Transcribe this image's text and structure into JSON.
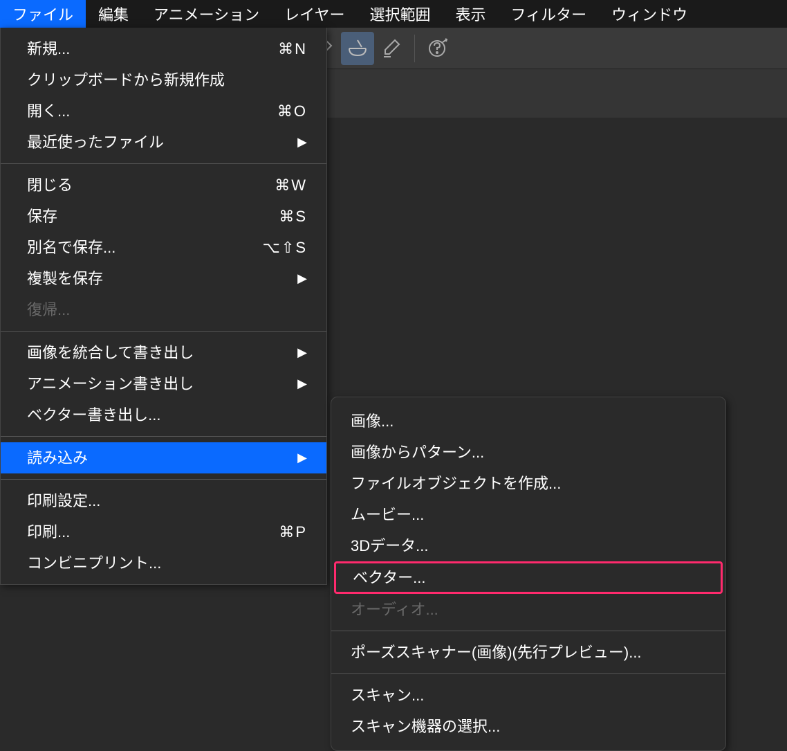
{
  "menubar": {
    "items": [
      {
        "label": "ファイル",
        "active": true
      },
      {
        "label": "編集",
        "active": false
      },
      {
        "label": "アニメーション",
        "active": false
      },
      {
        "label": "レイヤー",
        "active": false
      },
      {
        "label": "選択範囲",
        "active": false
      },
      {
        "label": "表示",
        "active": false
      },
      {
        "label": "フィルター",
        "active": false
      },
      {
        "label": "ウィンドウ",
        "active": false
      }
    ]
  },
  "dropdown": {
    "sections": [
      {
        "items": [
          {
            "label": "新規...",
            "shortcut": "⌘N",
            "arrow": false,
            "disabled": false
          },
          {
            "label": "クリップボードから新規作成",
            "shortcut": "",
            "arrow": false,
            "disabled": false
          },
          {
            "label": "開く...",
            "shortcut": "⌘O",
            "arrow": false,
            "disabled": false
          },
          {
            "label": "最近使ったファイル",
            "shortcut": "",
            "arrow": true,
            "disabled": false
          }
        ]
      },
      {
        "items": [
          {
            "label": "閉じる",
            "shortcut": "⌘W",
            "arrow": false,
            "disabled": false
          },
          {
            "label": "保存",
            "shortcut": "⌘S",
            "arrow": false,
            "disabled": false
          },
          {
            "label": "別名で保存...",
            "shortcut": "⌥⇧S",
            "arrow": false,
            "disabled": false
          },
          {
            "label": "複製を保存",
            "shortcut": "",
            "arrow": true,
            "disabled": false
          },
          {
            "label": "復帰...",
            "shortcut": "",
            "arrow": false,
            "disabled": true
          }
        ]
      },
      {
        "items": [
          {
            "label": "画像を統合して書き出し",
            "shortcut": "",
            "arrow": true,
            "disabled": false
          },
          {
            "label": "アニメーション書き出し",
            "shortcut": "",
            "arrow": true,
            "disabled": false
          },
          {
            "label": "ベクター書き出し...",
            "shortcut": "",
            "arrow": false,
            "disabled": false
          }
        ]
      },
      {
        "items": [
          {
            "label": "読み込み",
            "shortcut": "",
            "arrow": true,
            "disabled": false,
            "highlighted": true
          }
        ]
      },
      {
        "items": [
          {
            "label": "印刷設定...",
            "shortcut": "",
            "arrow": false,
            "disabled": false
          },
          {
            "label": "印刷...",
            "shortcut": "⌘P",
            "arrow": false,
            "disabled": false
          },
          {
            "label": "コンビニプリント...",
            "shortcut": "",
            "arrow": false,
            "disabled": false
          }
        ]
      }
    ]
  },
  "submenu": {
    "sections": [
      {
        "items": [
          {
            "label": "画像...",
            "disabled": false,
            "boxed": false
          },
          {
            "label": "画像からパターン...",
            "disabled": false,
            "boxed": false
          },
          {
            "label": "ファイルオブジェクトを作成...",
            "disabled": false,
            "boxed": false
          },
          {
            "label": "ムービー...",
            "disabled": false,
            "boxed": false
          },
          {
            "label": "3Dデータ...",
            "disabled": false,
            "boxed": false
          },
          {
            "label": "ベクター...",
            "disabled": false,
            "boxed": true
          },
          {
            "label": "オーディオ...",
            "disabled": true,
            "boxed": false
          }
        ]
      },
      {
        "items": [
          {
            "label": "ポーズスキャナー(画像)(先行プレビュー)...",
            "disabled": false,
            "boxed": false
          }
        ]
      },
      {
        "items": [
          {
            "label": "スキャン...",
            "disabled": false,
            "boxed": false
          },
          {
            "label": "スキャン機器の選択...",
            "disabled": false,
            "boxed": false
          }
        ]
      }
    ]
  }
}
